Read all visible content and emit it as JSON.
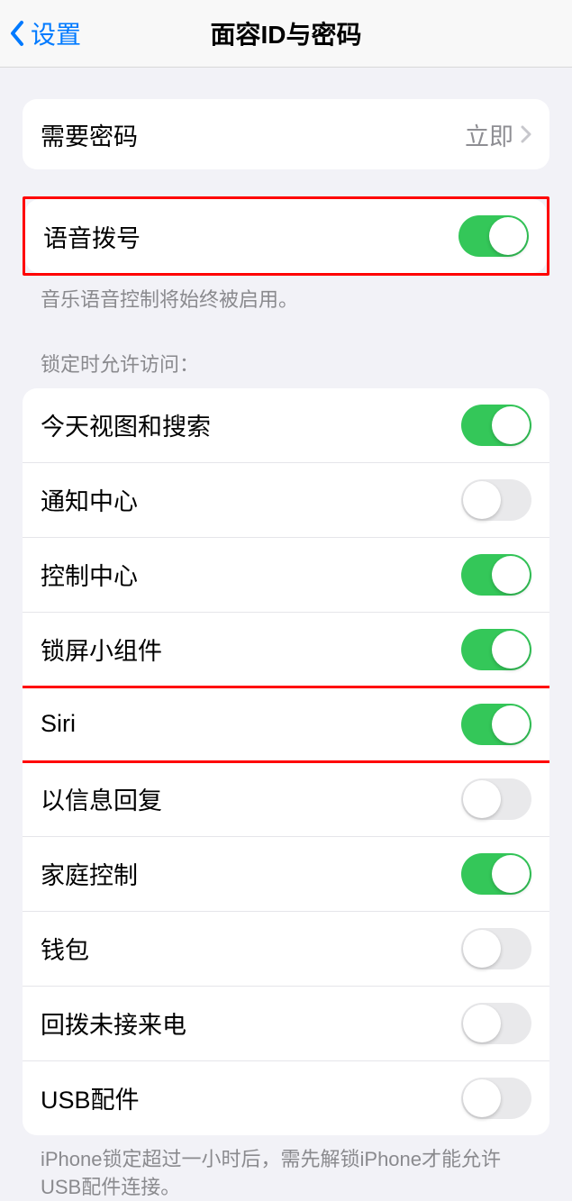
{
  "nav": {
    "back_label": "设置",
    "title": "面容ID与密码"
  },
  "require_passcode": {
    "label": "需要密码",
    "value": "立即"
  },
  "voice_dial": {
    "label": "语音拨号",
    "on": true,
    "footer": "音乐语音控制将始终被启用。"
  },
  "lock_section": {
    "header": "锁定时允许访问：",
    "items": [
      {
        "label": "今天视图和搜索",
        "on": true
      },
      {
        "label": "通知中心",
        "on": false
      },
      {
        "label": "控制中心",
        "on": true
      },
      {
        "label": "锁屏小组件",
        "on": true
      },
      {
        "label": "Siri",
        "on": true
      },
      {
        "label": "以信息回复",
        "on": false
      },
      {
        "label": "家庭控制",
        "on": true
      },
      {
        "label": "钱包",
        "on": false
      },
      {
        "label": "回拨未接来电",
        "on": false
      },
      {
        "label": "USB配件",
        "on": false
      }
    ],
    "footer": "iPhone锁定超过一小时后，需先解锁iPhone才能允许USB配件连接。"
  }
}
